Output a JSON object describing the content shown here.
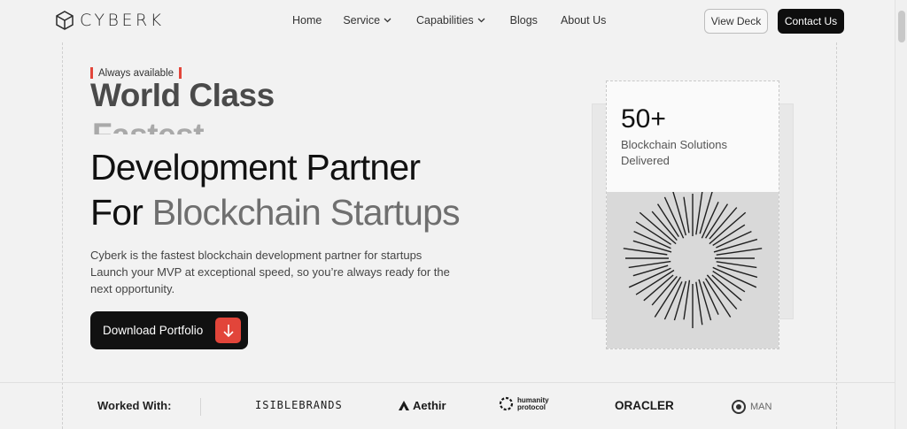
{
  "header": {
    "brand": "CYBERK",
    "nav": [
      {
        "label": "Home"
      },
      {
        "label": "Service"
      },
      {
        "label": "Capabilities"
      },
      {
        "label": "Blogs"
      },
      {
        "label": "About Us"
      }
    ],
    "view_deck": "View Deck",
    "contact": "Contact Us"
  },
  "hero": {
    "badge": "Always available",
    "rolling_word_1": "World Class",
    "rolling_word_2": "Fastest",
    "headline_line1": "Development Partner",
    "headline_line2_a": "For ",
    "headline_line2_b": "Blockchain Startups",
    "description": "Cyberk is the fastest blockchain development partner for startups Launch your MVP at exceptional speed, so you’re always ready for the next opportunity.",
    "cta": "Download Portfolio"
  },
  "stat": {
    "value": "50+",
    "label": "Blockchain Solutions Delivered"
  },
  "partners": {
    "title": "Worked With:",
    "logos": [
      "ISIBLEBRANDS",
      "Aethir",
      "humanity protocol",
      "ORACLER",
      "MAN"
    ]
  },
  "colors": {
    "accent": "#e2453a",
    "dark": "#111111",
    "background": "#f2f2f2"
  }
}
